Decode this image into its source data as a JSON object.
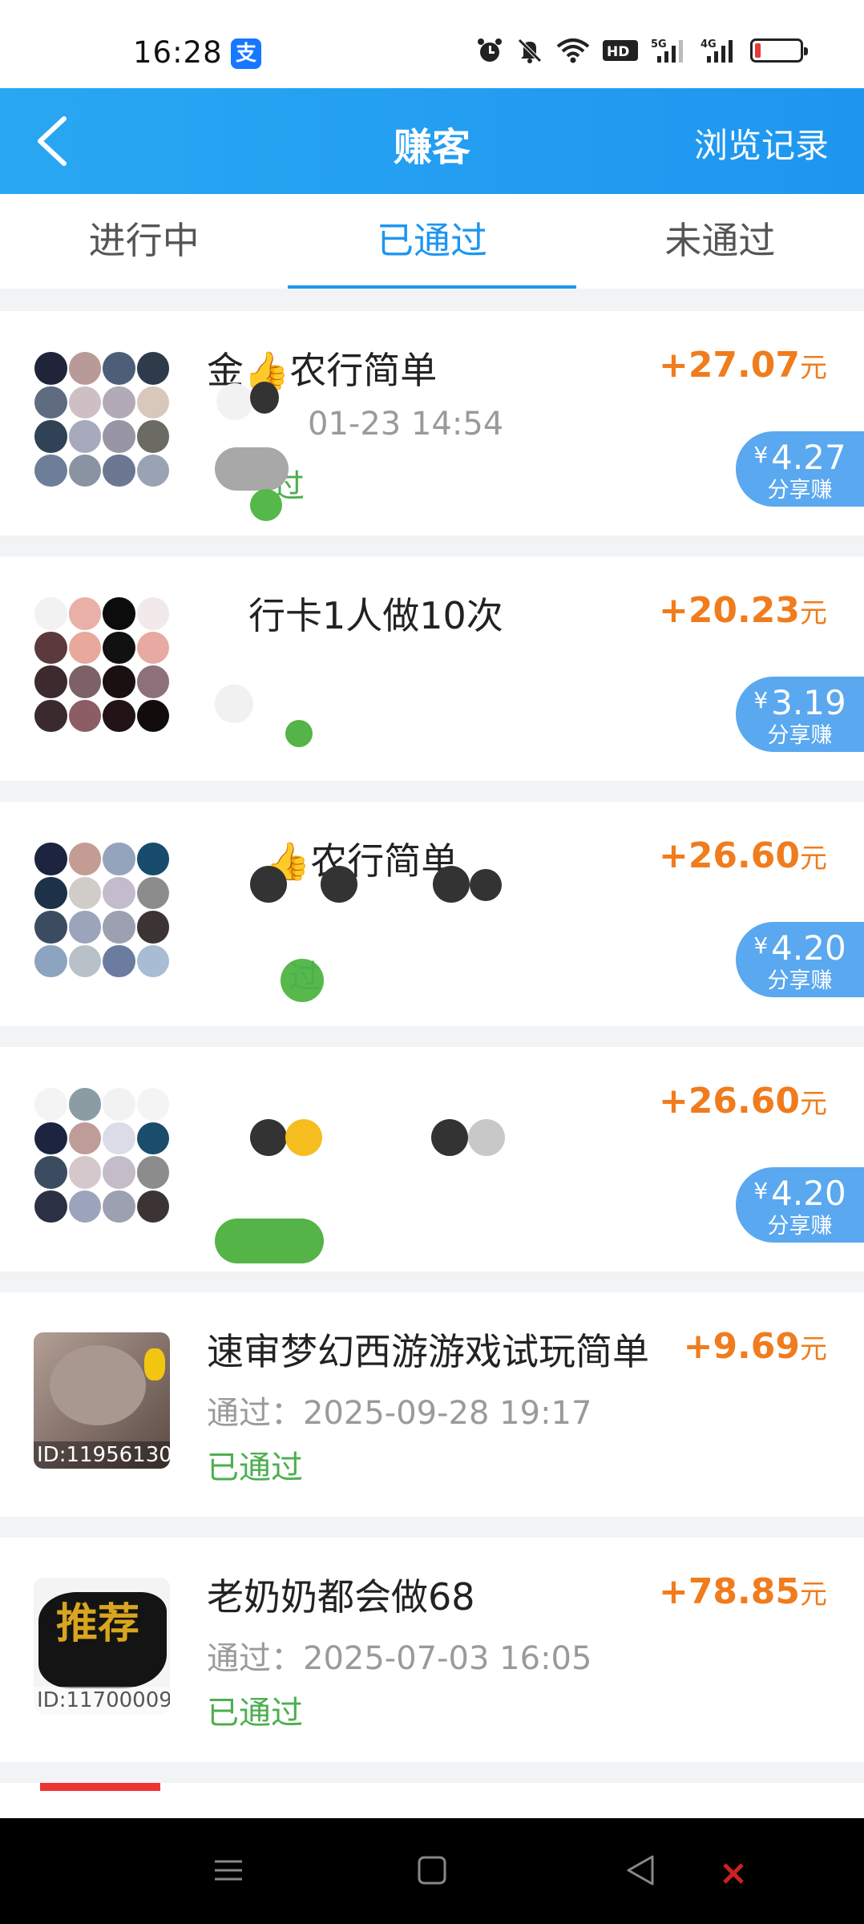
{
  "status_bar": {
    "time": "16:28",
    "alipay_badge": "支",
    "network_labels": [
      "HD",
      "5G",
      "4G"
    ]
  },
  "header": {
    "title": "赚客",
    "action": "浏览记录"
  },
  "tabs": [
    {
      "label": "进行中",
      "active": false
    },
    {
      "label": "已通过",
      "active": true
    },
    {
      "label": "未通过",
      "active": false
    }
  ],
  "tasks": [
    {
      "title": "金👍农行简单",
      "time": "01-23 14:54",
      "status": "过",
      "reward_sign": "+",
      "reward": "27.07",
      "unit": "元",
      "share_currency": "¥",
      "share_amount": "4.27",
      "share_label": "分享赚"
    },
    {
      "title": "行卡1人做10次",
      "time": "",
      "status": "",
      "reward_sign": "+",
      "reward": "20.23",
      "unit": "元",
      "share_currency": "¥",
      "share_amount": "3.19",
      "share_label": "分享赚"
    },
    {
      "title": "👍农行简单",
      "time": "",
      "status": "过",
      "reward_sign": "+",
      "reward": "26.60",
      "unit": "元",
      "share_currency": "¥",
      "share_amount": "4.20",
      "share_label": "分享赚"
    },
    {
      "title": "",
      "time": "",
      "status": "",
      "reward_sign": "+",
      "reward": "26.60",
      "unit": "元",
      "share_currency": "¥",
      "share_amount": "4.20",
      "share_label": "分享赚"
    },
    {
      "title": "速审梦幻西游游戏试玩简单",
      "time": "通过：2025-09-28 19:17",
      "status": "已通过",
      "reward_sign": "+",
      "reward": "9.69",
      "unit": "元",
      "thumb_id": "ID:11956130"
    },
    {
      "title": "老奶奶都会做68",
      "time": "通过：2025-07-03 16:05",
      "status": "已通过",
      "reward_sign": "+",
      "reward": "78.85",
      "unit": "元",
      "thumb_id": "ID:11700009",
      "thumb_text": "推荐"
    }
  ],
  "colors": {
    "header_blue": "#1e96f0",
    "reward_orange": "#f07c1d",
    "status_green": "#4caf50",
    "share_badge": "#5aa8ef"
  },
  "icons": [
    "back-arrow-icon",
    "alarm-icon",
    "mute-bell-icon",
    "wifi-icon",
    "battery-icon",
    "menu-icon",
    "home-icon",
    "back-triangle-icon"
  ]
}
